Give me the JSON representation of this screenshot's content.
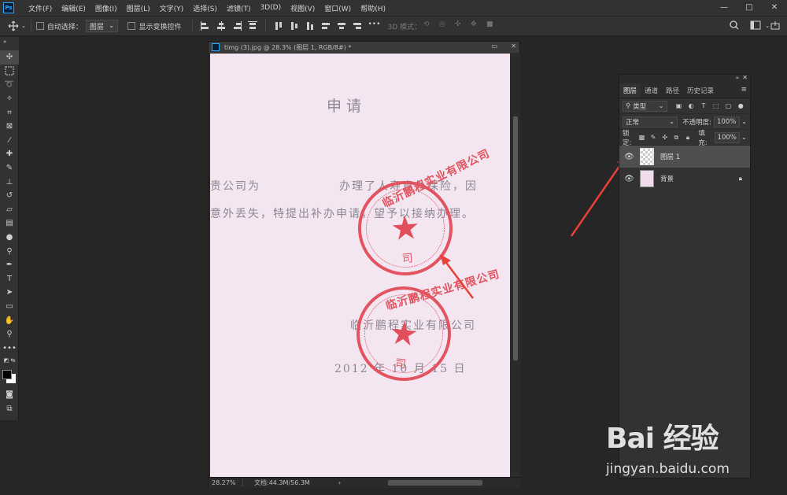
{
  "app": {
    "logo": "Ps",
    "colors": {
      "accent": "#31a8ff",
      "arrow": "#e8403a",
      "seal": "#e2545f",
      "paper": "#f3e6f1"
    }
  },
  "menu": [
    "文件(F)",
    "编辑(E)",
    "图像(I)",
    "图层(L)",
    "文字(Y)",
    "选择(S)",
    "滤镜(T)",
    "3D(D)",
    "视图(V)",
    "窗口(W)",
    "帮助(H)"
  ],
  "window_controls": [
    "—",
    "□",
    "✕"
  ],
  "options_bar": {
    "auto_select_label": "自动选择：",
    "auto_select_value": "图层",
    "show_transform_label": "显示变换控件",
    "mode_3d_label": "3D 模式："
  },
  "document": {
    "title": "timg (3).jpg @ 28.3% (图层 1, RGB/8#) *",
    "zoom": "28.27%",
    "doc_size": "文档:44.3M/56.3M",
    "content": {
      "heading": "申请",
      "line1_left": "贵公司为",
      "line1_right": "办理了人寿意外保险，因",
      "line2": "意外丢失，特提出补办申请，望予以接纳办理。",
      "company": "临沂鹏程实业有限公司",
      "date": "2012 年  10 月 15 日",
      "seal_text": "临沂鹏程实业有限公司",
      "seal_bottom": "司"
    }
  },
  "layers_panel": {
    "tabs": [
      "图层",
      "通道",
      "路径",
      "历史记录"
    ],
    "filter_label": "类型",
    "blend_mode": "正常",
    "opacity_label": "不透明度:",
    "opacity_value": "100%",
    "lock_label": "锁定:",
    "fill_label": "填充:",
    "fill_value": "100%",
    "layers": [
      {
        "name": "图层 1",
        "selected": true
      },
      {
        "name": "背景",
        "selected": false
      }
    ]
  },
  "watermark": {
    "brand": "Bai 经验",
    "url": "jingyan.baidu.com"
  }
}
